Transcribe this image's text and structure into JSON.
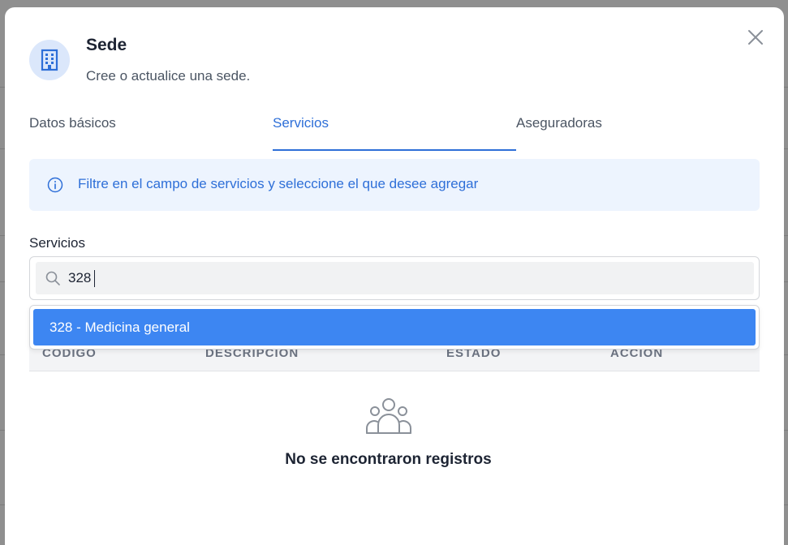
{
  "modal": {
    "title": "Sede",
    "subtitle": "Cree o actualice una sede."
  },
  "tabs": [
    {
      "label": "Datos básicos",
      "active": false
    },
    {
      "label": "Servicios",
      "active": true
    },
    {
      "label": "Aseguradoras",
      "active": false
    }
  ],
  "info": {
    "text": "Filtre en el campo de servicios y seleccione el que desee agregar"
  },
  "services_field": {
    "label": "Servicios",
    "value": "328"
  },
  "dropdown": {
    "options": [
      "328 - Medicina general"
    ]
  },
  "table": {
    "columns": [
      "CÓDIGO",
      "DESCRIPCIÓN",
      "ESTADO",
      "ACCIÓN"
    ]
  },
  "empty_state": {
    "text": "No se encontraron registros",
    "icon": "users-icon"
  },
  "colors": {
    "accent": "#2e6fd8",
    "option_highlight": "#3d86f2",
    "info_bg": "#edf4fe"
  }
}
